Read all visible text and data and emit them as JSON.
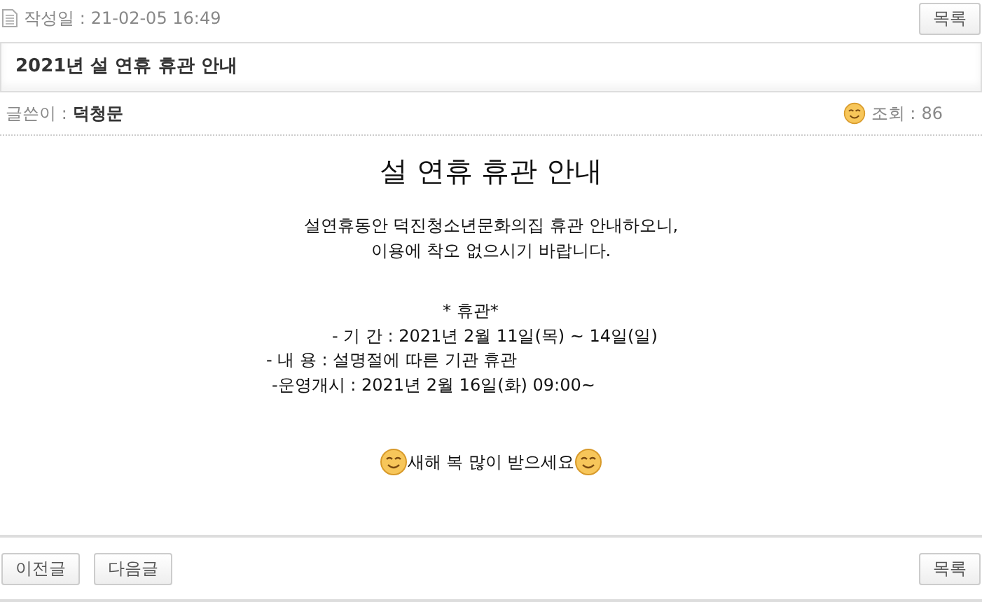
{
  "post_date": {
    "label": "작성일 :",
    "value": "21-02-05 16:49"
  },
  "list_button_top": "목록",
  "title": "2021년 설 연휴 휴관 안내",
  "author": {
    "label": "글쓴이 :",
    "value": "덕청문"
  },
  "views": {
    "label": "조회 :",
    "value": "86"
  },
  "body": {
    "heading": "설 연휴 휴관 안내",
    "intro": [
      "설연휴동안 덕진청소년문화의집 휴관 안내하오니,",
      "이용에 착오 없으시기 바랍니다."
    ],
    "details": [
      "* 휴관*",
      "- 기 간 : 2021년 2월 11일(목) ~ 14일(일)",
      "- 내 용 : 설명절에 따른 기관 휴관",
      "-운영개시 : 2021년 2월 16일(화) 09:00~"
    ],
    "greeting": "새해 복 많이 받으세요"
  },
  "nav_buttons": [
    "이전글",
    "다음글"
  ],
  "list_button_bottom": "목록"
}
